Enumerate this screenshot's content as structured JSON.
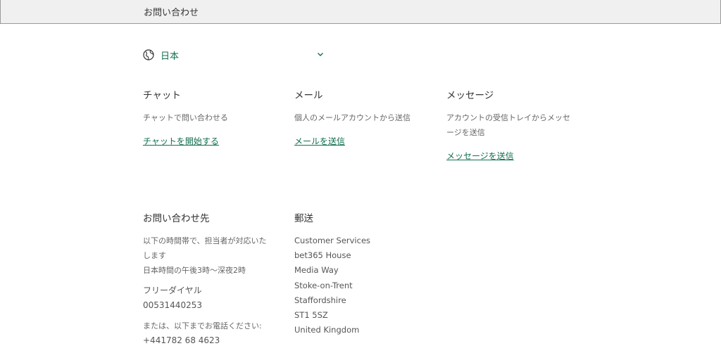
{
  "header": {
    "title": "お問い合わせ"
  },
  "country": {
    "label": "日本"
  },
  "channels": [
    {
      "title": "チャット",
      "desc": "チャットで問い合わせる",
      "link": "チャットを開始する"
    },
    {
      "title": "メール",
      "desc": "個人のメールアカウントから送信",
      "link": "メールを送信"
    },
    {
      "title": "メッセージ",
      "desc_line1": "アカウントの受信トレイからメッセ",
      "desc_line2": "ージを送信",
      "link": "メッセージを送信"
    }
  ],
  "contact": {
    "title": "お問い合わせ先",
    "hours_line1": "以下の時間帯で、担当者が対応いた",
    "hours_line2": "します",
    "hours_line3": "日本時間の午後3時～深夜2時",
    "freedial_label": "フリーダイヤル",
    "freedial_number": "00531440253",
    "alt_label": "または、以下までお電話ください:",
    "alt_number": "+441782 68 4623"
  },
  "post": {
    "title": "郵送",
    "lines": [
      "Customer Services",
      "bet365 House",
      "Media Way",
      "Stoke-on-Trent",
      "Staffordshire",
      "ST1 5SZ",
      "United Kingdom"
    ]
  },
  "colors": {
    "accent": "#126e51",
    "header_bg": "#f0f0f0"
  }
}
